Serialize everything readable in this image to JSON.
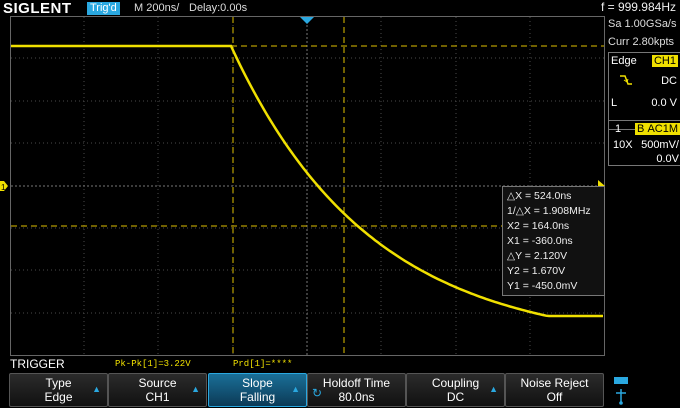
{
  "header": {
    "brand": "SIGLENT",
    "trig_status": "Trig'd",
    "timebase": "M 200ns/",
    "delay": "Delay:0.00s",
    "frequency": "f = 999.984Hz"
  },
  "right_panel": {
    "sample_rate": "Sa 1.00GSa/s",
    "memory": "Curr 2.80kpts",
    "trigger_type": "Edge",
    "trigger_source": "CH1",
    "coupling": "DC",
    "level_label": "L",
    "level_value": "0.0 V",
    "channel_number": "1",
    "bw_flag": "B",
    "channel_coupling": "AC1M",
    "probe": "10X",
    "volts_div": "500mV/",
    "offset": "0.0V"
  },
  "measurements": {
    "dx": "△X = 524.0ns",
    "inv_dx": "1/△X = 1.908MHz",
    "x2": "X2 = 164.0ns",
    "x1": "X1 = -360.0ns",
    "dy": "△Y = 2.120V",
    "y2": "Y2 = 1.670V",
    "y1": "Y1 = -450.0mV"
  },
  "status_bar": {
    "menu_title": "TRIGGER",
    "pkpk": "Pk-Pk[1]=3.22V",
    "prd": "Prd[1]=****"
  },
  "softkeys": [
    {
      "label": "Type",
      "value": "Edge"
    },
    {
      "label": "Source",
      "value": "CH1"
    },
    {
      "label": "Slope",
      "value": "Falling"
    },
    {
      "label": "Holdoff Time",
      "value": "80.0ns"
    },
    {
      "label": "Coupling",
      "value": "DC"
    },
    {
      "label": "Noise Reject",
      "value": "Off"
    }
  ],
  "colors": {
    "trace": "#f0e000",
    "accent": "#2aa8e0",
    "grid": "#555555"
  },
  "icons": {
    "channel_marker": "1",
    "trigger_level_marker": "triangle-left",
    "trigger_position_marker": "triangle-down",
    "slope_icon": "falling-edge-icon",
    "usb_icon": "usb-icon"
  }
}
